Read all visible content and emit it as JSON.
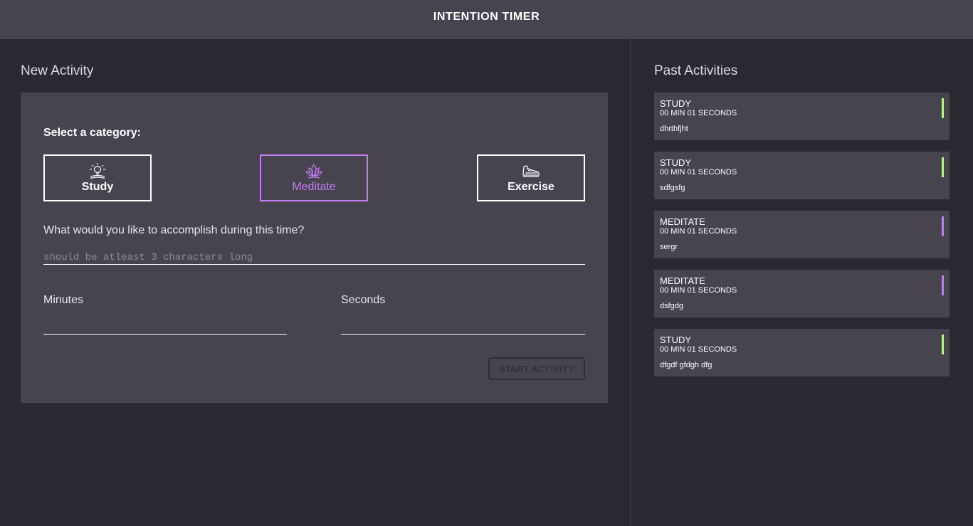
{
  "header": {
    "title": "INTENTION TIMER"
  },
  "new_activity": {
    "title": "New Activity",
    "category_label": "Select a category:",
    "categories": [
      {
        "label": "Study",
        "icon": "lightbulb-icon",
        "selected": false
      },
      {
        "label": "Meditate",
        "icon": "lotus-icon",
        "selected": true
      },
      {
        "label": "Exercise",
        "icon": "shoe-icon",
        "selected": false
      }
    ],
    "intention_label": "What would you like to accomplish during this time?",
    "intention_placeholder": "should be atleast 3 characters long",
    "intention_value": "",
    "minutes_label": "Minutes",
    "minutes_value": "",
    "seconds_label": "Seconds",
    "seconds_value": "",
    "start_button": "START ACTIVITY"
  },
  "past_activities": {
    "title": "Past Activities",
    "items": [
      {
        "category": "STUDY",
        "time": "00 MIN 01 SECONDS",
        "description": "dhrthfjht",
        "color": "#b3fd78"
      },
      {
        "category": "STUDY",
        "time": "00 MIN 01 SECONDS",
        "description": "sdfgsfg",
        "color": "#b3fd78"
      },
      {
        "category": "MEDITATE",
        "time": "00 MIN 01 SECONDS",
        "description": "sergr",
        "color": "#c27df2"
      },
      {
        "category": "MEDITATE",
        "time": "00 MIN 01 SECONDS",
        "description": "dsfgdg",
        "color": "#c27df2"
      },
      {
        "category": "STUDY",
        "time": "00 MIN 01 SECONDS",
        "description": "dfgdf gfdgh dfg",
        "color": "#b3fd78"
      }
    ]
  },
  "colors": {
    "background": "#2a2831",
    "panel": "#47444f",
    "study_accent": "#b3fd78",
    "meditate_accent": "#c27df2"
  }
}
